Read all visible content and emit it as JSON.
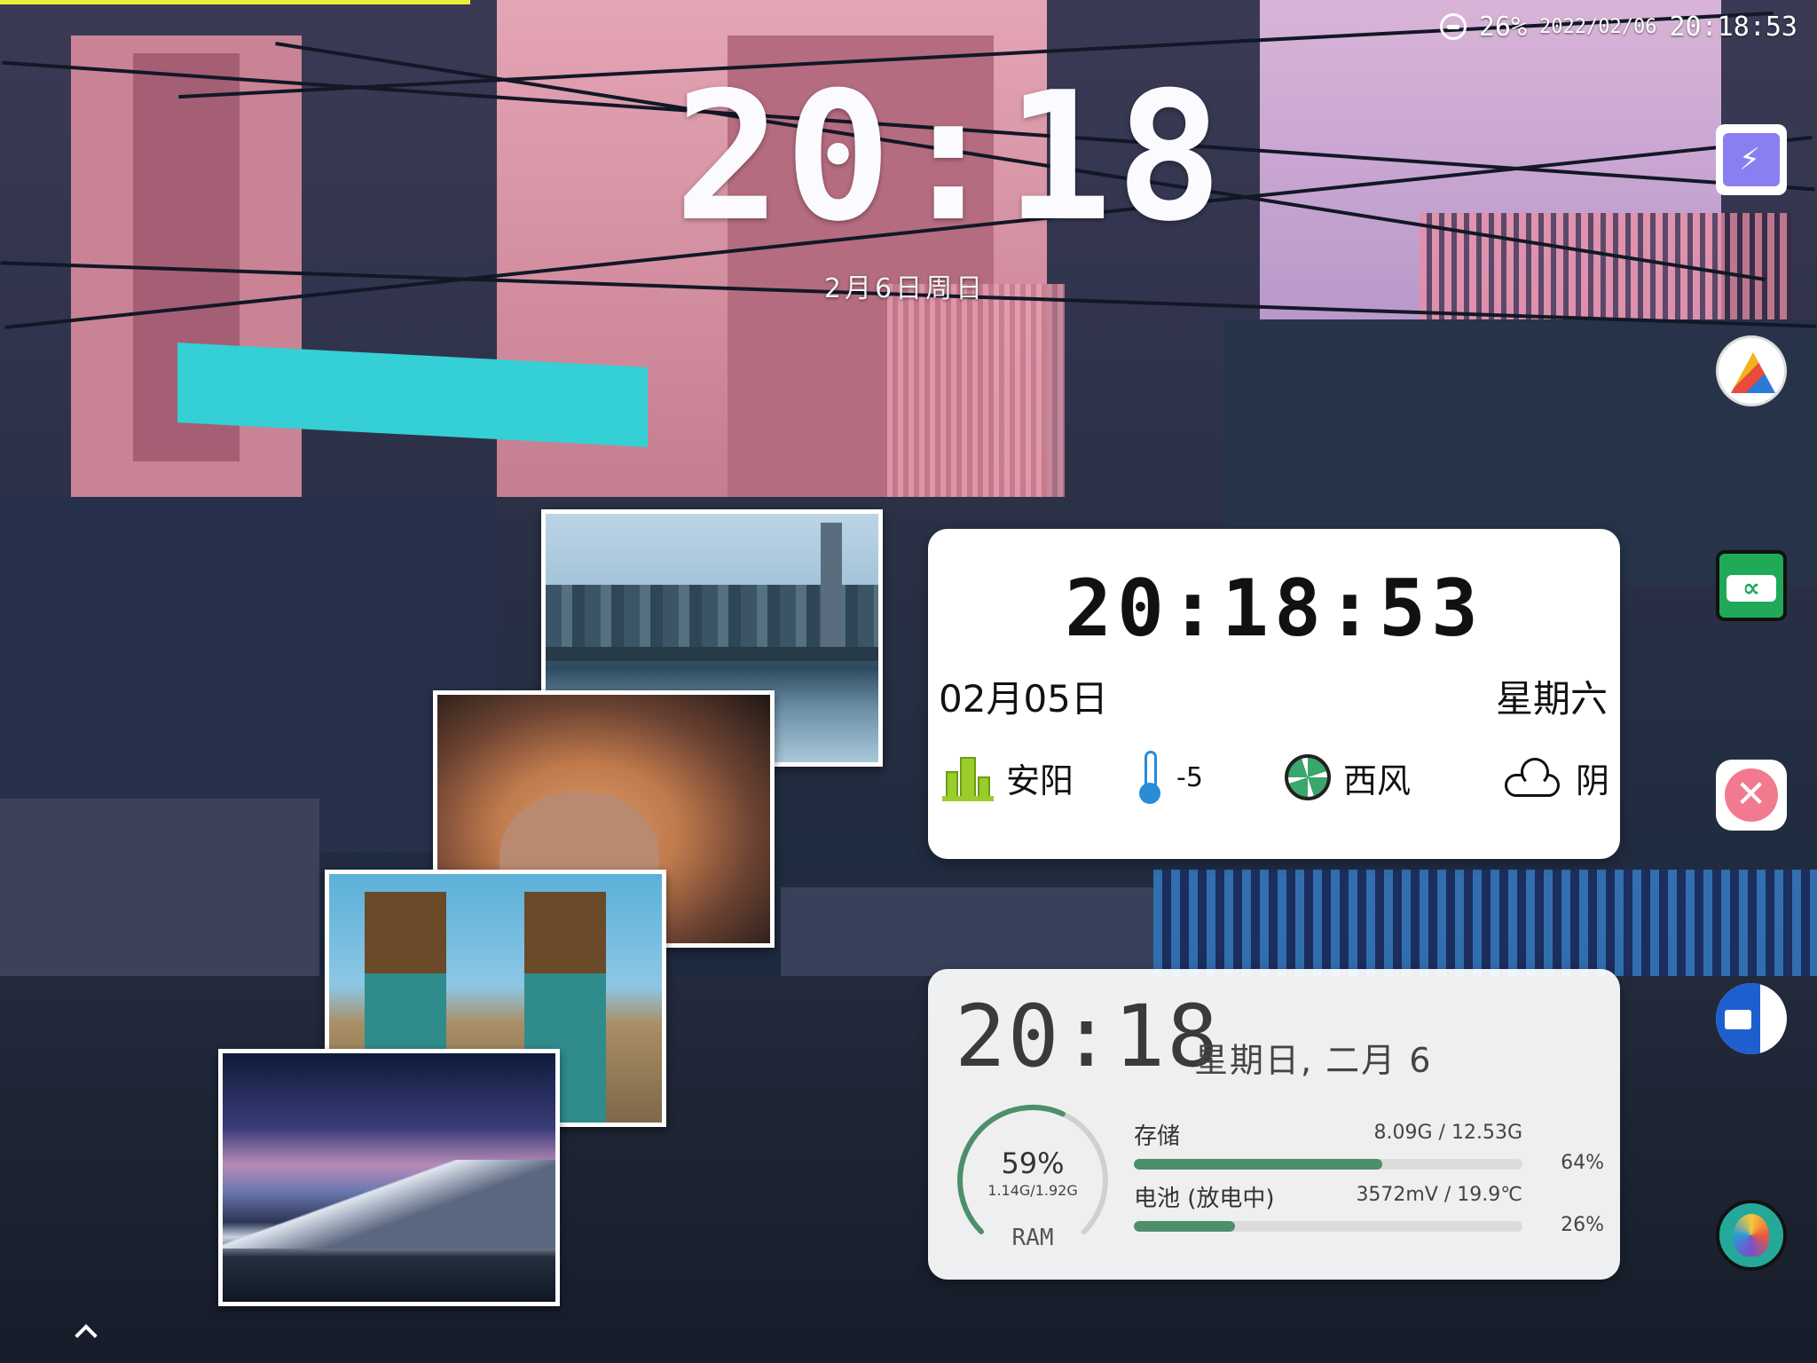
{
  "status_bar": {
    "dnd_icon": "do-not-disturb-icon",
    "battery": "26%",
    "date": "2022/02/06",
    "time": "20:18:53"
  },
  "lockscreen_clock": {
    "time": "20:18",
    "date": "2月6日周日"
  },
  "photo_stack": {
    "photos": [
      "city-skyline-photo",
      "dog-meme-photo",
      "minecraft-steve-photo",
      "milky-way-mountains-photo"
    ]
  },
  "weather_widget": {
    "time": "20:18:53",
    "date": "02月05日",
    "weekday": "星期六",
    "city": "安阳",
    "temperature": "-5",
    "wind": "西风",
    "condition": "阴",
    "icons": [
      "city-icon",
      "thermometer-icon",
      "wind-icon",
      "cloud-icon"
    ]
  },
  "system_widget": {
    "time": "20:18",
    "date": "星期日, 二月 6",
    "ram": {
      "percent": "59%",
      "detail": "1.14G/1.92G",
      "label": "RAM",
      "fraction": 0.59
    },
    "storage": {
      "label": "存储",
      "value": "8.09G / 12.53G",
      "percent": "64%",
      "fraction": 0.64
    },
    "battery": {
      "label": "电池 (放电中)",
      "value": "3572mV / 19.9℃",
      "percent": "26%",
      "fraction": 0.26
    }
  },
  "dock": {
    "apps": [
      "flash-app-icon",
      "triangle-app-icon",
      "green-app-icon",
      "bandage-app-icon",
      "files-app-icon",
      "colorful-app-icon"
    ]
  },
  "colors": {
    "accent_green": "#4d8f6a",
    "ring_track": "#d0d0d0",
    "top_strip": "#e6f03a"
  }
}
